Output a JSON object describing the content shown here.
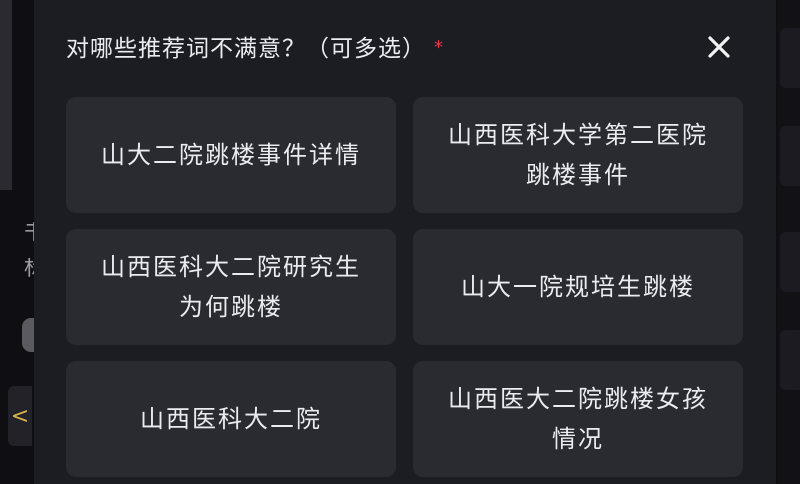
{
  "dialog": {
    "title": "对哪些推荐词不满意？（可多选）",
    "required_mark": "*",
    "close_label": "✕"
  },
  "options": [
    {
      "label": "山大二院跳楼事件详情"
    },
    {
      "label": "山西医科大学第二医院跳楼事件"
    },
    {
      "label": "山西医科大二院研究生为何跳楼"
    },
    {
      "label": "山大一院规培生跳楼"
    },
    {
      "label": "山西医科大二院"
    },
    {
      "label": "山西医大二院跳楼女孩情况"
    }
  ],
  "background": {
    "left_text": [
      "书",
      "标"
    ],
    "back_arrow": "<"
  }
}
